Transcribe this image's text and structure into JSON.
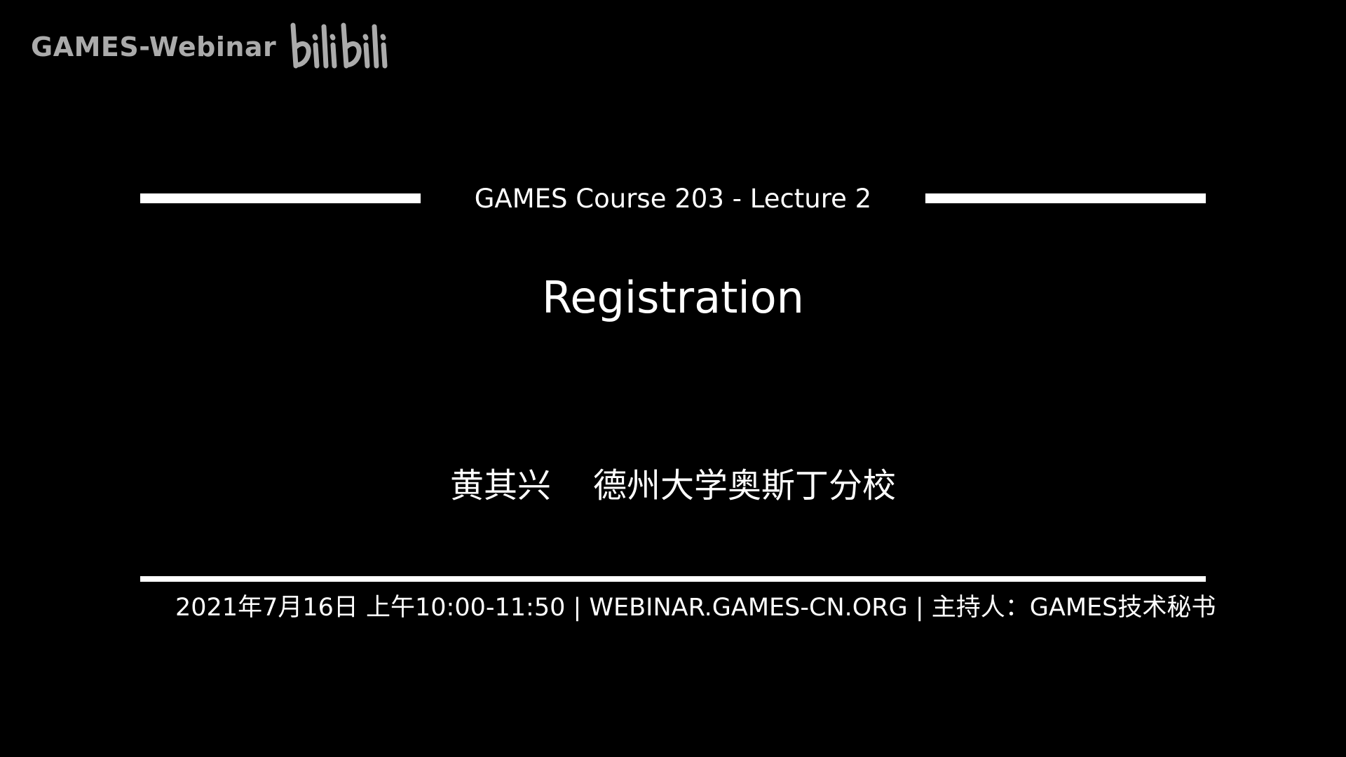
{
  "watermark": {
    "channel": "GAMES-Webinar",
    "logo": "bilibili",
    "logo_color": "#d6d6d6"
  },
  "slide": {
    "course": "GAMES Course 203 - Lecture 2",
    "title": "Registration",
    "speaker_name": "黄其兴",
    "speaker_affiliation": "德州大学奥斯丁分校",
    "info": "2021年7月16日 上午10:00-11:50 | WEBINAR.GAMES-CN.ORG | 主持人：GAMES技术秘书"
  },
  "colors": {
    "background": "#000000",
    "foreground": "#ffffff"
  }
}
